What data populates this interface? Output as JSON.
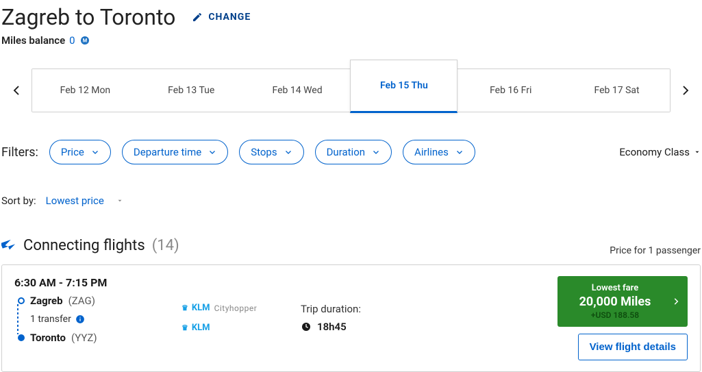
{
  "header": {
    "title": "Zagreb to Toronto",
    "change_label": "CHANGE",
    "miles_label": "Miles balance",
    "miles_value": "0"
  },
  "dates": {
    "tabs": [
      {
        "label": "Feb 12 Mon",
        "selected": false
      },
      {
        "label": "Feb 13 Tue",
        "selected": false
      },
      {
        "label": "Feb 14 Wed",
        "selected": false
      },
      {
        "label": "Feb 15 Thu",
        "selected": true
      },
      {
        "label": "Feb 16 Fri",
        "selected": false
      },
      {
        "label": "Feb 17 Sat",
        "selected": false
      }
    ]
  },
  "filters": {
    "label": "Filters:",
    "pills": [
      "Price",
      "Departure time",
      "Stops",
      "Duration",
      "Airlines"
    ],
    "cabin": "Economy Class"
  },
  "sort": {
    "label": "Sort by:",
    "value": "Lowest price"
  },
  "section": {
    "title": "Connecting flights",
    "count": "(14)",
    "pax_note": "Price for 1 passenger"
  },
  "flight": {
    "times": "6:30 AM - 7:15 PM",
    "origin_city": "Zagreb",
    "origin_code": "(ZAG)",
    "transfer": "1 transfer",
    "dest_city": "Toronto",
    "dest_code": "(YYZ)",
    "airline1_name": "KLM",
    "airline1_sub": "Cityhopper",
    "airline2_name": "KLM",
    "duration_label": "Trip duration:",
    "duration_value": "18h45",
    "fare_title": "Lowest fare",
    "fare_miles": "20,000 Miles",
    "fare_cash": "+USD 188.58",
    "detail_btn": "View flight details"
  }
}
